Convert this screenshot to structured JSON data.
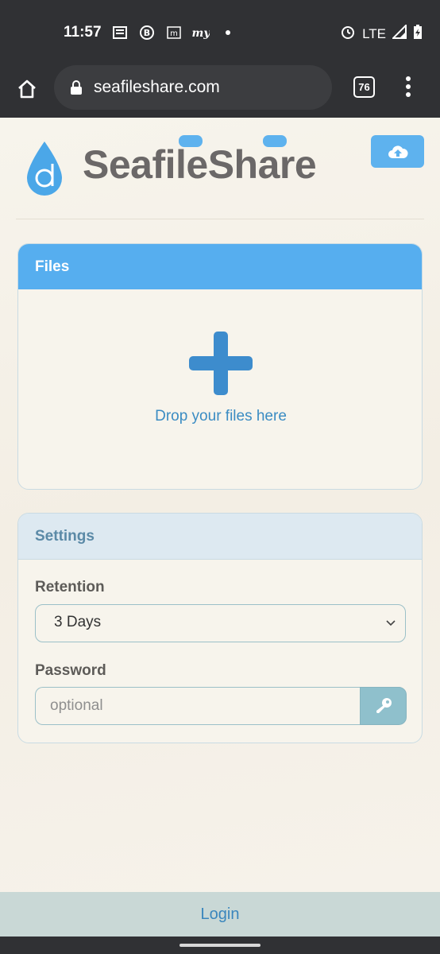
{
  "status_bar": {
    "time": "11:57",
    "left_icons": [
      "news-icon",
      "b-badge-icon",
      "m-badge-icon",
      "my-app-icon",
      "dot-icon"
    ],
    "network": "LTE",
    "right_icons": [
      "alarm-icon",
      "signal-icon",
      "battery-charging-icon"
    ]
  },
  "browser": {
    "url": "seafileshare.com",
    "tab_count": "76"
  },
  "site": {
    "brand": "SeafileShare",
    "upload_icon": "cloud-upload-icon"
  },
  "files": {
    "header": "Files",
    "drop_text": "Drop your files here"
  },
  "settings": {
    "header": "Settings",
    "retention_label": "Retention",
    "retention_value": "3 Days",
    "password_label": "Password",
    "password_placeholder": "optional"
  },
  "footer": {
    "login": "Login"
  },
  "colors": {
    "accent_blue": "#56aeef",
    "dark_bar": "#303134",
    "page_bg": "#f5f1e8",
    "link_blue": "#3a86bd"
  }
}
